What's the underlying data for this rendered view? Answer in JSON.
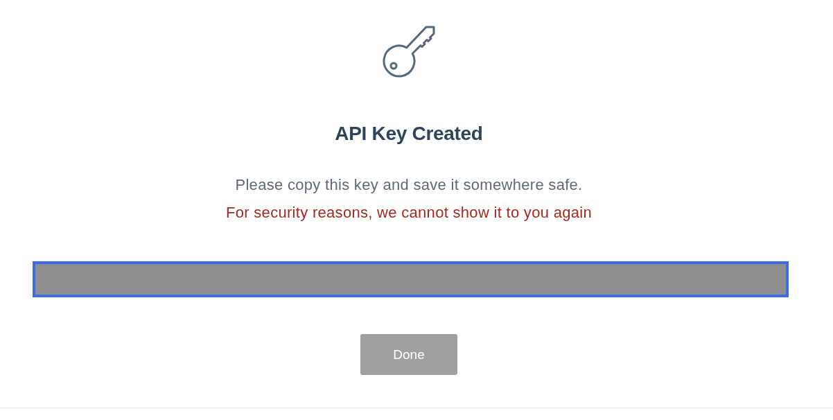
{
  "title": "API Key Created",
  "message": "Please copy this key and save it somewhere safe.",
  "warning": "For security reasons, we cannot show it to you again",
  "key_field": {
    "focused": true
  },
  "button": {
    "label": "Done"
  }
}
